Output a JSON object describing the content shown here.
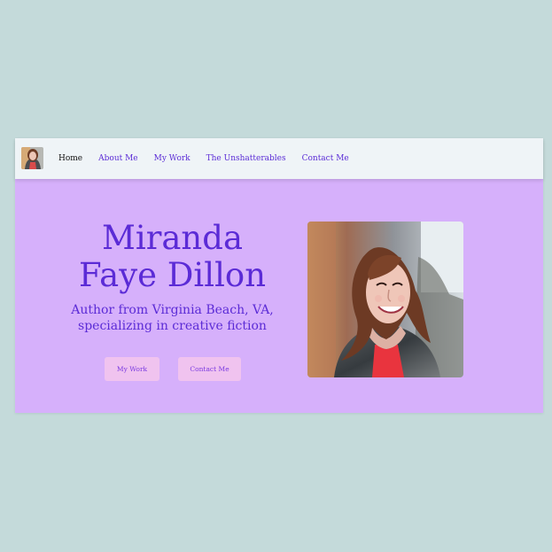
{
  "nav": {
    "items": [
      {
        "label": "Home"
      },
      {
        "label": "About Me"
      },
      {
        "label": "My Work"
      },
      {
        "label": "The Unshatterables"
      },
      {
        "label": "Contact Me"
      }
    ],
    "active_item": "Home"
  },
  "hero": {
    "name_line_1": "Miranda",
    "name_line_2": "Faye Dillon",
    "subtitle_line_1": "Author from Virginia Beach, VA,",
    "subtitle_line_2": "specializing in creative fiction",
    "buttons": {
      "my_work": "My Work",
      "contact_me": "Contact Me"
    },
    "portrait_icon": "author-portrait"
  },
  "colors": {
    "background": "#c4dada",
    "hero_background": "#d6b0fb",
    "navbar_background": "#eff4f7",
    "accent": "#5b2bd6",
    "button_background": "#f0c3ef",
    "button_text": "#7a3be0"
  }
}
